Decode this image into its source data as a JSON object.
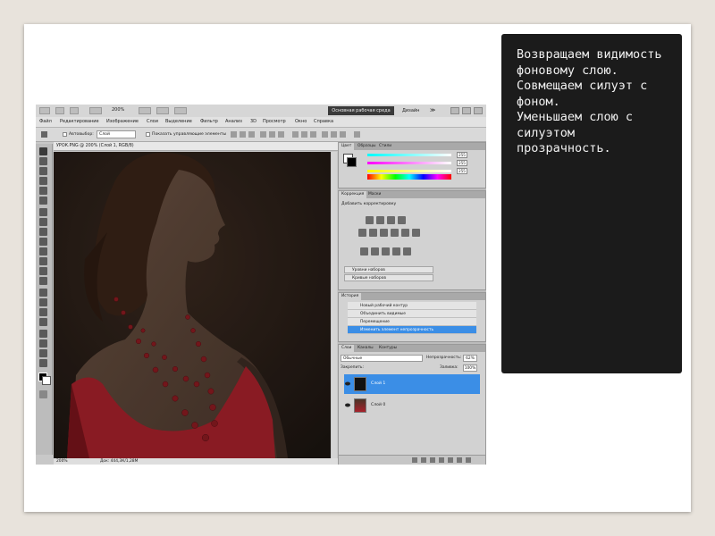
{
  "slide_text": {
    "lines": [
      "Возвращаем видимость фоновому слою.",
      "Совмещаем силуэт с фоном.",
      "Уменьшаем слою с силуэтом прозрачность."
    ]
  },
  "photoshop": {
    "topbar": {
      "zoom": "200%",
      "workspace_active": "Основная рабочая среда",
      "workspace_other": "Дизайн",
      "more": "≫"
    },
    "menu": [
      "Файл",
      "Редактирование",
      "Изображение",
      "Слои",
      "Выделение",
      "Фильтр",
      "Анализ",
      "3D",
      "Просмотр",
      "Окно",
      "Справка"
    ],
    "options": {
      "autoselect": "Автовыбор:",
      "autoselect_value": "Слой",
      "show_controls": "Показать управляющие элементы"
    },
    "document_tab": "УРОК.PNG @ 200% (Слой 1, RGB/8)",
    "status": {
      "zoom": "200%",
      "doc": "Док: 444,3К/1,28М"
    },
    "color_panel": {
      "tabs": [
        "Цвет",
        "Образцы",
        "Стили"
      ],
      "values": [
        "255",
        "255",
        "255"
      ]
    },
    "adjustments_panel": {
      "tabs": [
        "Коррекция",
        "Маски"
      ],
      "title": "Добавить корректировку",
      "presets": [
        "Уровни наборов",
        "Кривые наборов"
      ]
    },
    "history_panel": {
      "tab": "История",
      "items": [
        "Новый рабочий контур",
        "Объединить видимые",
        "Перемещение",
        "Изменить элемент непрозрачность"
      ]
    },
    "layers_panel": {
      "tabs": [
        "Слои",
        "Каналы",
        "Контуры"
      ],
      "blend_mode": "Обычные",
      "opacity_label": "Непрозрачность:",
      "opacity_value": "62%",
      "lock_label": "Закрепить:",
      "fill_label": "Заливка:",
      "fill_value": "100%",
      "layers": [
        {
          "name": "Слой 1",
          "selected": true
        },
        {
          "name": "Слой 0",
          "selected": false
        }
      ]
    }
  },
  "colors": {
    "selection_blue": "#3b8ee6",
    "text_panel_bg": "#1b1b1b"
  }
}
